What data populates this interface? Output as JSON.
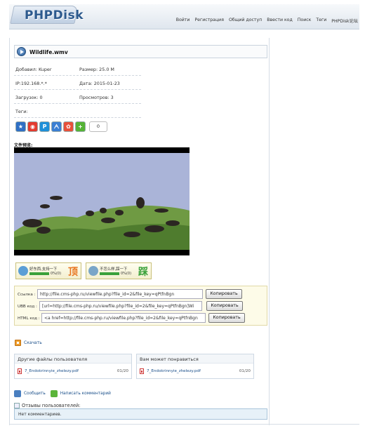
{
  "header": {
    "logo": "PHPDisk",
    "nav": [
      "Войти",
      "Регистрация",
      "Общий доступ",
      "Ввести код",
      "Поиск",
      "Теги",
      "PHPDisk论坛"
    ]
  },
  "file": {
    "title": "Wildlife.wmv",
    "info": {
      "added_by": "Добавил: Kuper",
      "size": "Размер: 25.0 M",
      "ip": "IP:192.168.*.*",
      "date": "Дата: 2015-01-23",
      "downloads": "Загрузок: 0",
      "views": "Просмотров: 3",
      "tags": "Теги:"
    },
    "share_count": "0",
    "preview_label": "文件预览:",
    "share_icons": [
      "favorite-star-icon",
      "weibo-icon",
      "qzone-icon",
      "renren-icon",
      "kaixin-icon",
      "plus-share-icon"
    ]
  },
  "votes": {
    "good": {
      "label": "好东西,支持一下",
      "percent": "0%(0)",
      "char": "顶"
    },
    "bad": {
      "label": "不怎么样,踩一下",
      "percent": "0%(0)",
      "char": "踩"
    }
  },
  "links": {
    "url": {
      "label": "Ссылка :",
      "value": "http://file.cms-php.ru/viewfile.php?file_id=2&file_key=qPtfnBgn",
      "button": "Копировать"
    },
    "ubb": {
      "label": "UBB код :",
      "value": "[url=http://file.cms-php.ru/viewfile.php?file_id=2&file_key=qPtfnBgn]Wi",
      "button": "Копировать"
    },
    "html": {
      "label": "HTML код :",
      "value": "<a href=http://file.cms-php.ru/viewfile.php?file_id=2&file_key=qPtfnBgn",
      "button": "Копировать"
    }
  },
  "download_label": "Скачать",
  "panels": {
    "other_files": {
      "title": "Другие файлы пользователя",
      "file": "7_Endokrinnyie_zhelezy.pdf",
      "date": "01/20"
    },
    "you_may_like": {
      "title": "Вам может понравиться",
      "file": "7_Endokrinnyie_zhelezy.pdf",
      "date": "01/20"
    }
  },
  "actions": {
    "report": "Сообщить",
    "comment": "Написать комментарий"
  },
  "comments": {
    "label": "Отзывы пользователей:",
    "empty": "Нет комментариев."
  },
  "colors": {
    "accent": "#1a4f8a",
    "vote_good": "#e8741e",
    "vote_bad": "#3aa13a"
  }
}
